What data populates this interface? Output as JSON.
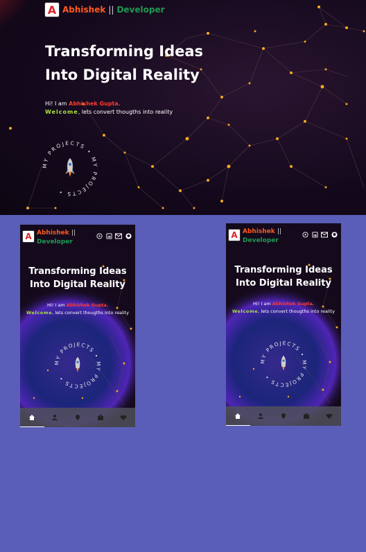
{
  "brand": {
    "logo_letter": "A",
    "name": "Abhishek",
    "separator": "||",
    "role": "Developer"
  },
  "hero": {
    "headline_line1": "Transforming Ideas",
    "headline_line2": "Into Digital Reality",
    "greeting_prefix": "Hi! I am",
    "greeting_name": "Abhishek Gupta",
    "greeting_suffix": ".",
    "welcome": "Welcome",
    "tagline": ", lets convert thougths into reality",
    "badge_text": "MY PROJECTS • MY PROJECTS •"
  },
  "header_icons": [
    "whatsapp-icon",
    "linkedin-icon",
    "mail-icon",
    "github-icon"
  ],
  "nav_items": [
    "home-icon",
    "user-icon",
    "location-icon",
    "briefcase-icon",
    "gem-icon"
  ],
  "colors": {
    "page_bg": "#5a5eb8",
    "accent_orange": "#ff5a1f",
    "accent_green": "#1f9a52",
    "name_red": "#ff3b2e",
    "welcome_green": "#a7e63b",
    "node": "#f5a623"
  }
}
